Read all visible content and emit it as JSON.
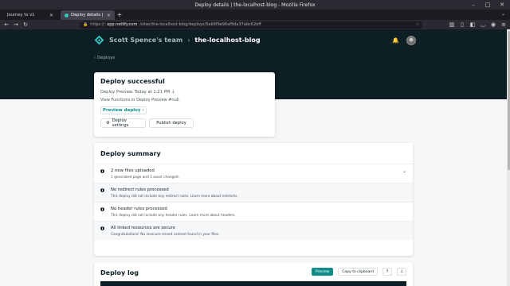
{
  "window": {
    "title": "Deploy details | the-localhost-blog - Mozilla Firefox"
  },
  "tabs": [
    {
      "label": "Journey to v1",
      "active": false
    },
    {
      "label": "Deploy details | the-localhost-blog",
      "active": true
    }
  ],
  "toolbar": {
    "url_prefix": "https://",
    "url_host": "app.netlify.com",
    "url_path": "/sites/the-localhost-blog/deploys/5eb9f9e96af9da37abc62eff"
  },
  "header": {
    "team_name": "Scott Spence's team",
    "separator": "›",
    "site_name": "the-localhost-blog",
    "back_label": "‹ Deploys"
  },
  "deploy_card": {
    "title": "Deploy successful",
    "meta": "Deploy Preview. Today at 1:21 PM",
    "functions_text": "View Functions in Deploy Preview #null.",
    "preview_link": "Preview deploy",
    "deploy_settings_label": "Deploy settings",
    "publish_label": "Publish deploy"
  },
  "summary": {
    "title": "Deploy summary",
    "rows": [
      {
        "title": "2 new files uploaded",
        "desc": "1 generated page and 1 asset changed."
      },
      {
        "title": "No redirect rules processed",
        "desc": "This deploy did not include any redirect rules. Learn more about redirects."
      },
      {
        "title": "No header rules processed",
        "desc": "This deploy did not include any header rules. Learn more about headers."
      },
      {
        "title": "All linked resources are secure",
        "desc": "Congratulations! No insecure mixed content found in your files."
      }
    ]
  },
  "log": {
    "title": "Deploy log",
    "preview_label": "Preview",
    "copy_label": "Copy to clipboard",
    "up_label": "↑",
    "down_label": "↓"
  },
  "colors": {
    "hero": "#0e1e25",
    "accent": "#0d8d87",
    "page_bg": "#f5f7f8"
  },
  "icons": [
    "netlify-logo-icon",
    "bell-icon",
    "avatar",
    "download-icon",
    "gear-icon",
    "info-icon",
    "chevron-down-icon",
    "arrow-up-icon",
    "arrow-down-icon"
  ]
}
